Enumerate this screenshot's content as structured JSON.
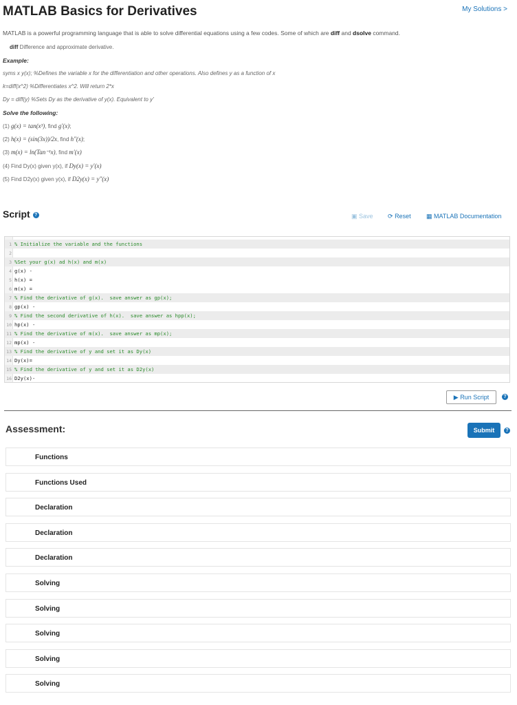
{
  "header": {
    "title": "MATLAB Basics for Derivatives",
    "my_solutions": "My Solutions >"
  },
  "intro": {
    "text_a": "MATLAB is a powerful programming language that is able to solve differential equations using a few codes.   Some of which are ",
    "diff": "diff",
    "and": " and ",
    "dsolve": "dsolve",
    "text_b": " command.",
    "diff_label": "diff",
    "diff_desc": " Difference and approximate derivative."
  },
  "example": {
    "heading": "Example:",
    "line1": "syms x y(x);   %Defines the variable x for the differentiation and other operations.  Also defines y as a function of x",
    "line2": "k=diff(x^2)    %Differentiates x^2.  Will return 2*x",
    "line3": "Dy = diff(y)    %Sets Dy as the derivative of y(x). Equivalent to y'"
  },
  "problems": {
    "heading": "Solve the following:",
    "p1_prefix": "(1) ",
    "p1_math": "g(x) = tan(x³)",
    "p1_mid": ", find ",
    "p1_find": "g′(x)",
    "p1_end": ";",
    "p2_prefix": "(2) ",
    "p2_math": "h(x) = (sin(3x))/2x",
    "p2_mid": ", find ",
    "p2_find": "h″(x)",
    "p2_end": ";",
    "p3_prefix": "(3) ",
    "p3_math": "m(x) = ln(Tan⁻¹x)",
    "p3_mid": ", find ",
    "p3_find": "m′(x)",
    "p4_text": "(4) Find Dy(x) given y(x), if ",
    "p4_math": "Dy(x) = y′(x)",
    "p5_text": "(5) Find D2y(x) given y(x), if ",
    "p5_math": "D2y(x) = y″(x)"
  },
  "script": {
    "heading": "Script",
    "help": "?",
    "save": "Save",
    "reset": "Reset",
    "docs": "MATLAB Documentation",
    "lines": [
      {
        "n": "1",
        "text": "% Initialize the variable and the functions"
      },
      {
        "n": "2",
        "text": ""
      },
      {
        "n": "3",
        "text": "%Set your g(x) ad h(x) and m(x)"
      },
      {
        "n": "4",
        "text": "g(x) -"
      },
      {
        "n": "5",
        "text": "h(x) ="
      },
      {
        "n": "6",
        "text": "m(x) ="
      },
      {
        "n": "7",
        "text": "% Find the derivative of g(x).  save answer as gp(x);"
      },
      {
        "n": "8",
        "text": "gp(x) -"
      },
      {
        "n": "9",
        "text": "% Find the second derivative of h(x).  save answer as hpp(x);"
      },
      {
        "n": "10",
        "text": "hp(x) -"
      },
      {
        "n": "11",
        "text": "% Find the derivative of m(x).  save answer as mp(x);"
      },
      {
        "n": "12",
        "text": "mp(x) -"
      },
      {
        "n": "13",
        "text": "% Find the derivative of y and set it as Dy(x)"
      },
      {
        "n": "14",
        "text": "Dy(x)="
      },
      {
        "n": "15",
        "text": "% Find the derivative of y and set it as D2y(x)"
      },
      {
        "n": "16",
        "text": "D2y(x)-"
      }
    ],
    "run": "▶ Run Script"
  },
  "assessment": {
    "heading": "Assessment:",
    "submit": "Submit",
    "help": "?",
    "items": [
      "Functions",
      "Functions Used",
      "Declaration",
      "Declaration",
      "Declaration",
      "Solving",
      "Solving",
      "Solving",
      "Solving",
      "Solving"
    ]
  },
  "colors": {
    "accent": "#1a73b8",
    "comment": "#2a8a2a"
  }
}
